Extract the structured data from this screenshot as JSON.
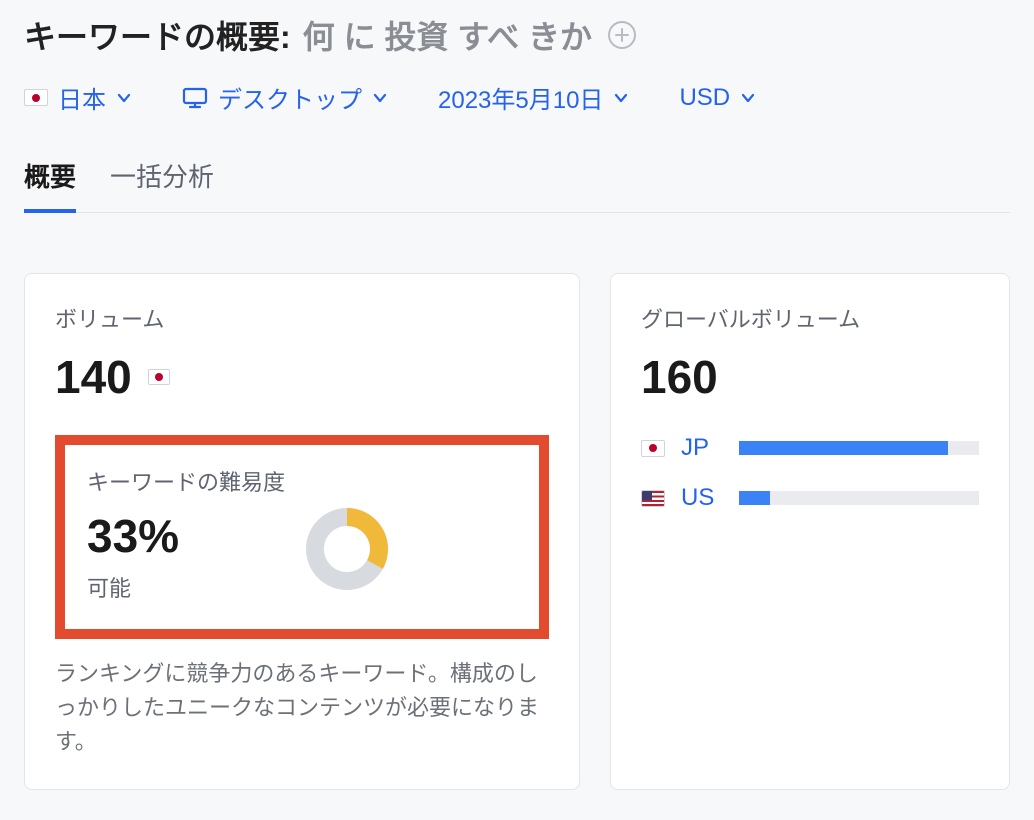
{
  "header": {
    "title_prefix": "キーワードの概要:",
    "query": "何 に 投資 すべ きか"
  },
  "filters": {
    "country_label": "日本",
    "device_label": "デスクトップ",
    "date_label": "2023年5月10日",
    "currency_label": "USD"
  },
  "tabs": {
    "overview": "概要",
    "bulk": "一括分析"
  },
  "volume": {
    "label": "ボリューム",
    "value": "140"
  },
  "difficulty": {
    "label": "キーワードの難易度",
    "percent": "33%",
    "sub": "可能",
    "description": "ランキングに競争力のあるキーワード。構成のしっかりしたユニークなコンテンツが必要になります。"
  },
  "global": {
    "label": "グローバルボリューム",
    "value": "160",
    "rows": [
      {
        "cc": "JP",
        "pct": 87
      },
      {
        "cc": "US",
        "pct": 13
      }
    ]
  },
  "chart_data": {
    "type": "bar",
    "title": "グローバルボリューム",
    "categories": [
      "JP",
      "US"
    ],
    "values": [
      140,
      20
    ],
    "ylabel": "ボリューム",
    "ylim": [
      0,
      160
    ]
  }
}
